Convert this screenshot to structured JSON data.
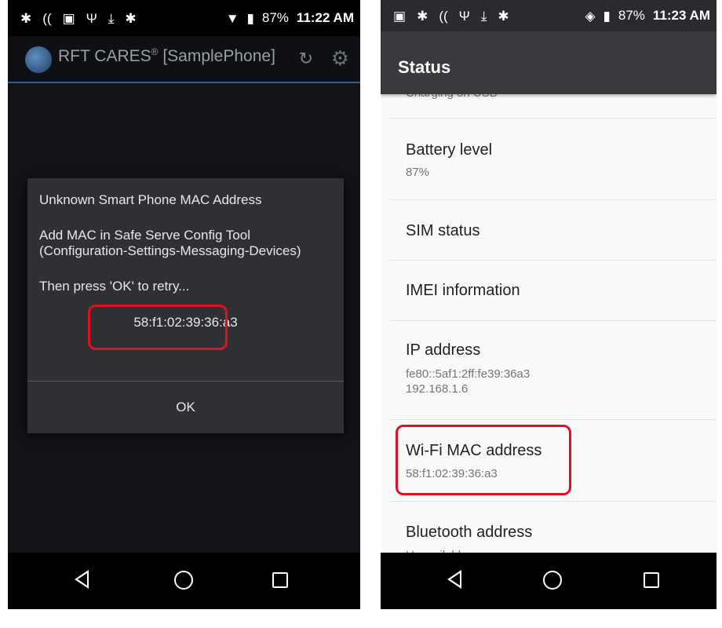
{
  "left": {
    "statusbar": {
      "battery": "87%",
      "time": "11:22 AM"
    },
    "appbar": {
      "title": "RFT CARES",
      "title_mark": "®",
      "title_suffix": " [SamplePhone]"
    },
    "dialog": {
      "title": "Unknown Smart Phone MAC Address",
      "line1": "Add MAC in Safe Serve Config Tool",
      "line2": "(Configuration-Settings-Messaging-Devices)",
      "line3": "Then press 'OK' to retry...",
      "mac": "58:f1:02:39:36:a3",
      "ok_label": "OK"
    }
  },
  "right": {
    "statusbar": {
      "battery": "87%",
      "time": "11:23 AM"
    },
    "appbar": {
      "title": "Status"
    },
    "rows": [
      {
        "title": "",
        "sub": "Charging on USB"
      },
      {
        "title": "Battery level",
        "sub": "87%"
      },
      {
        "title": "SIM status",
        "sub": ""
      },
      {
        "title": "IMEI information",
        "sub": ""
      },
      {
        "title": "IP address",
        "sub": "fe80::5af1:2ff:fe39:36a3",
        "sub2": "192.168.1.6"
      },
      {
        "title": "Wi-Fi MAC address",
        "sub": "58:f1:02:39:36:a3"
      },
      {
        "title": "Bluetooth address",
        "sub": "Unavailable"
      }
    ]
  },
  "colors": {
    "highlight": "#e0101e",
    "dialog_bg": "#2f3033",
    "appbar_right": "#3a3a3e"
  },
  "icons": [
    "android-debug-icon",
    "wifi-signal-icon",
    "image-icon",
    "usb-icon",
    "download-icon",
    "wifi-icon",
    "battery-charging-icon",
    "refresh-icon",
    "gear-icon",
    "back-icon",
    "home-icon",
    "recents-icon"
  ]
}
